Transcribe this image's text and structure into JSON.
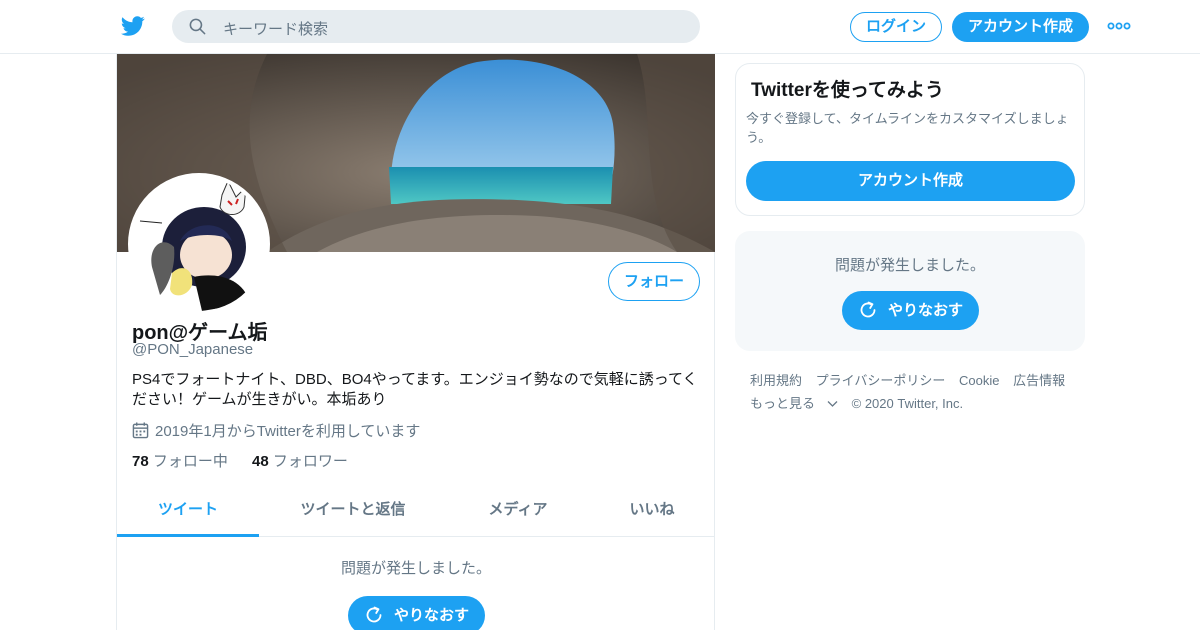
{
  "header": {
    "search_placeholder": "キーワード検索",
    "login_label": "ログイン",
    "signup_label": "アカウント作成",
    "brand_color": "#1da1f2"
  },
  "profile": {
    "follow_label": "フォロー",
    "display_name": "pon@ゲーム垢",
    "handle": "@PON_Japanese",
    "bio": "PS4でフォートナイト、DBD、BO4やってます。エンジョイ勢なので気軽に誘ってください！ゲームが生きがい。本垢あり",
    "joined": "2019年1月からTwitterを利用しています",
    "following_count": "78",
    "following_label": "フォロー中",
    "followers_count": "48",
    "followers_label": "フォロワー"
  },
  "tabs": [
    {
      "label": "ツイート",
      "active": true
    },
    {
      "label": "ツイートと返信",
      "active": false
    },
    {
      "label": "メディア",
      "active": false
    },
    {
      "label": "いいね",
      "active": false
    }
  ],
  "timeline": {
    "error_text": "問題が発生しました。",
    "retry_label": "やりなおす"
  },
  "signup_card": {
    "title": "Twitterを使ってみよう",
    "description": "今すぐ登録して、タイムラインをカスタマイズしましょう。",
    "button_label": "アカウント作成"
  },
  "side_error": {
    "error_text": "問題が発生しました。",
    "retry_label": "やりなおす"
  },
  "footer": {
    "links": [
      "利用規約",
      "プライバシーポリシー",
      "Cookie",
      "広告情報"
    ],
    "more_label": "もっと見る",
    "copyright": "© 2020 Twitter, Inc."
  }
}
